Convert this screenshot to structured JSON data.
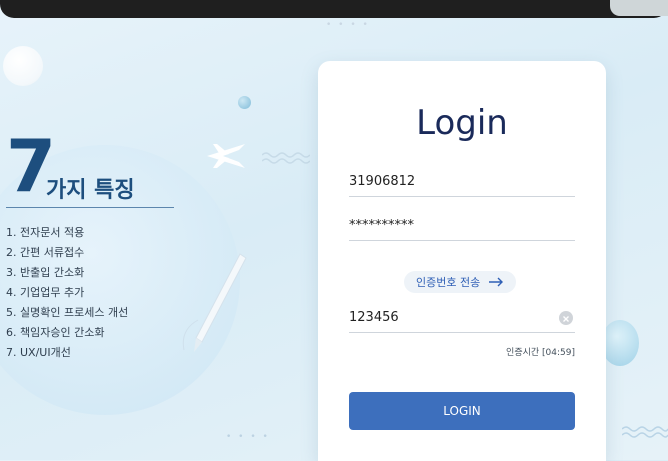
{
  "features": {
    "number": "7",
    "title": "가지 특징",
    "items": [
      "1. 전자문서 적용",
      "2. 간편 서류접수",
      "3. 반출입 간소화",
      "4. 기업업무 추가",
      "5. 실명확인 프로세스 개선",
      "6. 책임자승인 간소화",
      "7. UX/UI개선"
    ]
  },
  "login": {
    "title": "Login",
    "id_value": "31906812",
    "password_value": "**********",
    "auth_send_label": "인증번호 전송",
    "auth_code_value": "123456",
    "timer_label": "인증시간 [04:59]",
    "button_label": "LOGIN"
  },
  "colors": {
    "accent": "#3d6fbd",
    "title": "#1d4e7e"
  }
}
